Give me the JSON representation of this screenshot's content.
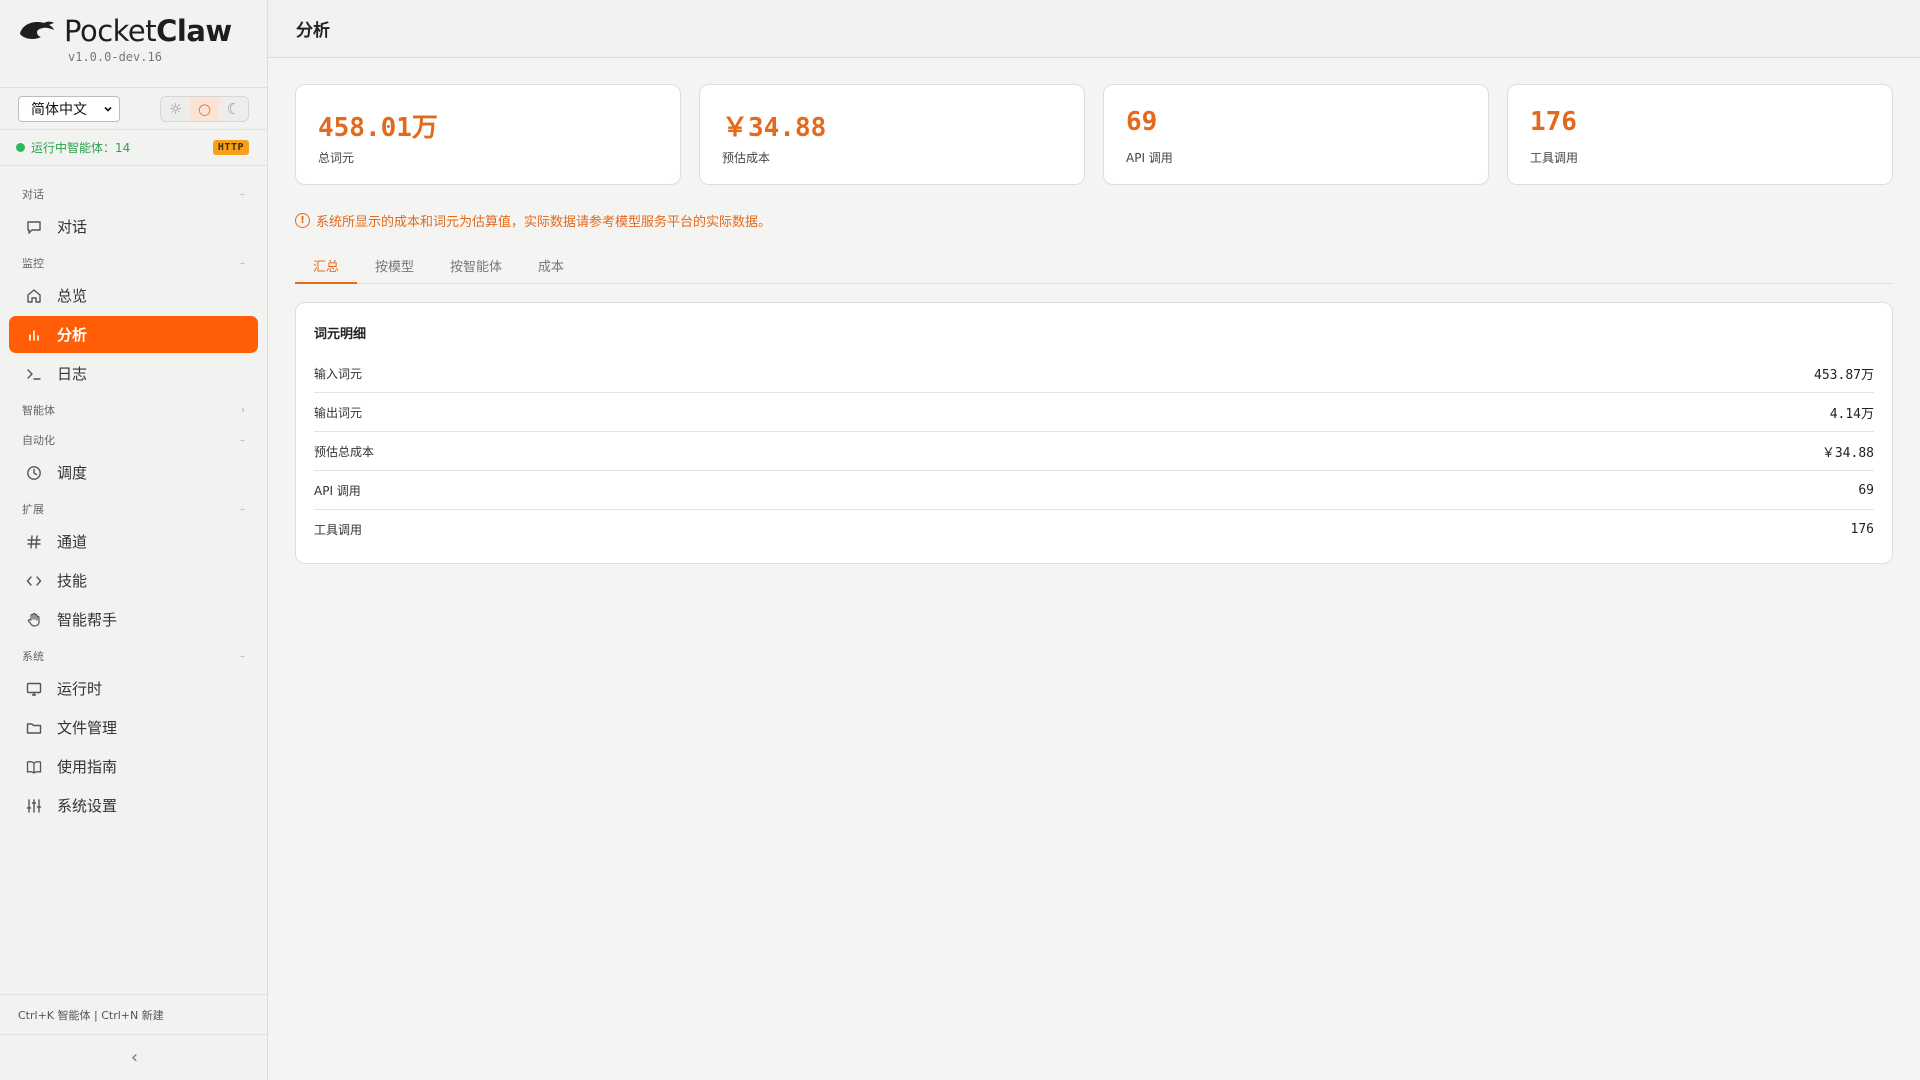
{
  "brand": {
    "name_light": "Pocket",
    "name_bold": "Claw",
    "version": "v1.0.0-dev.16"
  },
  "controls": {
    "language": "简体中文",
    "themes": [
      {
        "icon": "sun-icon",
        "glyph": "☼",
        "active": false
      },
      {
        "icon": "circle-icon",
        "glyph": "○",
        "active": true
      },
      {
        "icon": "moon-icon",
        "glyph": "☾",
        "active": false
      }
    ]
  },
  "status": {
    "text": "运行中智能体：14",
    "badge": "HTTP"
  },
  "nav": {
    "sections": {
      "chat": "对话",
      "monitor": "监控",
      "agents": "智能体",
      "automation": "自动化",
      "extensions": "扩展",
      "system": "系统"
    },
    "items": {
      "chat": "对话",
      "overview": "总览",
      "analytics": "分析",
      "logs": "日志",
      "schedule": "调度",
      "channels": "通道",
      "skills": "技能",
      "assistant": "智能帮手",
      "runtime": "运行时",
      "files": "文件管理",
      "guide": "使用指南",
      "settings": "系统设置"
    }
  },
  "footer": {
    "shortcut": "Ctrl+K 智能体 | Ctrl+N 新建",
    "collapse_glyph": "‹"
  },
  "page": {
    "title": "分析"
  },
  "stats": [
    {
      "value": "458.01万",
      "label": "总词元"
    },
    {
      "value": "￥34.88",
      "label": "预估成本"
    },
    {
      "value": "69",
      "label": "API 调用"
    },
    {
      "value": "176",
      "label": "工具调用"
    }
  ],
  "notice": {
    "text": "系统所显示的成本和词元为估算值，实际数据请参考模型服务平台的实际数据。"
  },
  "tabs": [
    "汇总",
    "按模型",
    "按智能体",
    "成本"
  ],
  "detail": {
    "title": "词元明细",
    "rows": [
      {
        "label": "输入词元",
        "value": "453.87万"
      },
      {
        "label": "输出词元",
        "value": "4.14万"
      },
      {
        "label": "预估总成本",
        "value": "￥34.88"
      },
      {
        "label": "API 调用",
        "value": "69"
      },
      {
        "label": "工具调用",
        "value": "176"
      }
    ]
  },
  "colors": {
    "accent": "#ff5e06",
    "accent_text": "#e3691c",
    "status_green": "#2fba5a",
    "badge": "#f5a21a"
  }
}
